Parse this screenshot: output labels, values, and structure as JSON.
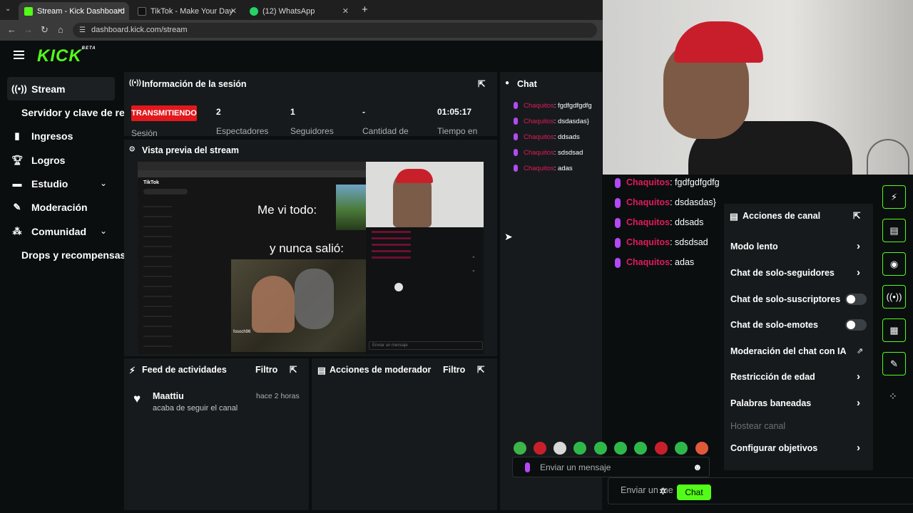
{
  "browser": {
    "tabs": [
      {
        "title": "Stream - Kick Dashboard",
        "active": true
      },
      {
        "title": "TikTok - Make Your Day",
        "active": false
      },
      {
        "title": "(12) WhatsApp",
        "active": false
      }
    ],
    "new_tab": "+",
    "url": "dashboard.kick.com/stream"
  },
  "brand": {
    "logo": "KICK",
    "beta": "BETA",
    "accent": "#53fc18"
  },
  "sidebar": {
    "items": [
      {
        "label": "Stream",
        "icon": "broadcast-icon"
      },
      {
        "label": "Servidor y clave de re",
        "icon": ""
      },
      {
        "label": "Ingresos",
        "icon": "bar-chart-icon"
      },
      {
        "label": "Logros",
        "icon": "trophy-icon"
      },
      {
        "label": "Estudio",
        "icon": "video-icon"
      },
      {
        "label": "Moderación",
        "icon": "wrench-icon"
      },
      {
        "label": "Comunidad",
        "icon": "community-icon"
      },
      {
        "label": "Drops y recompensas",
        "icon": ""
      }
    ]
  },
  "session": {
    "title": "Información de la sesión",
    "status": "TRANSMITIENDO",
    "status_sub": "Sesión",
    "stats": [
      {
        "value": "2",
        "label": "Espectadores"
      },
      {
        "value": "1",
        "label": "Seguidores"
      },
      {
        "value": "-",
        "label": "Cantidad de"
      },
      {
        "value": "01:05:17",
        "label": "Tiempo en"
      }
    ]
  },
  "preview": {
    "title": "Vista previa del stream",
    "caption1": "Me vi todo:",
    "caption2": "y nunca salió:",
    "tiktok_label": "TikTok",
    "mini_chat_placeholder": "Enviar un mensaje",
    "video_user": "fosoch96"
  },
  "feed": {
    "title": "Feed de actividades",
    "filter": "Filtro",
    "items": [
      {
        "user": "Maattiu",
        "action": "acaba de seguir el canal",
        "time": "hace 2 horas"
      }
    ]
  },
  "mod_actions": {
    "title": "Acciones de moderador",
    "filter": "Filtro"
  },
  "chat": {
    "title": "Chat",
    "messages": [
      {
        "user": "Chaquitos",
        "text": ": fgdfgdfgdfg"
      },
      {
        "user": "Chaquitos",
        "text": ": dsdasdas}"
      },
      {
        "user": "Chaquitos",
        "text": ": ddsads"
      },
      {
        "user": "Chaquitos",
        "text": ": sdsdsad"
      },
      {
        "user": "Chaquitos",
        "text": ": adas"
      }
    ],
    "input_placeholder": "Enviar un mensaje",
    "send": "Chat",
    "input_placeholder_2": "Enviar un me"
  },
  "overlay_chat": {
    "messages": [
      {
        "user": "Chaquitos",
        "text": ": fgdfgdfgdfg"
      },
      {
        "user": "Chaquitos",
        "text": ": dsdasdas}"
      },
      {
        "user": "Chaquitos",
        "text": ": ddsads"
      },
      {
        "user": "Chaquitos",
        "text": ": sdsdsad"
      },
      {
        "user": "Chaquitos",
        "text": ": adas"
      }
    ]
  },
  "channel_actions": {
    "title": "Acciones de canal",
    "options": [
      {
        "label": "Modo lento",
        "control": "arrow"
      },
      {
        "label": "Chat de solo-seguidores",
        "control": "arrow"
      },
      {
        "label": "Chat de solo-suscriptores",
        "control": "toggle",
        "on": false
      },
      {
        "label": "Chat de solo-emotes",
        "control": "toggle",
        "on": false
      },
      {
        "label": "Moderación del chat con IA",
        "control": "external"
      },
      {
        "label": "Restricción de edad",
        "control": "arrow"
      },
      {
        "label": "Palabras baneadas",
        "control": "arrow"
      },
      {
        "label": "Hostear canal",
        "control": "disabled"
      },
      {
        "label": "Configurar objetivos",
        "control": "arrow"
      }
    ]
  },
  "colors": {
    "live": "#e2181d",
    "username": "#e01b5a",
    "mic": "#b449f5"
  }
}
